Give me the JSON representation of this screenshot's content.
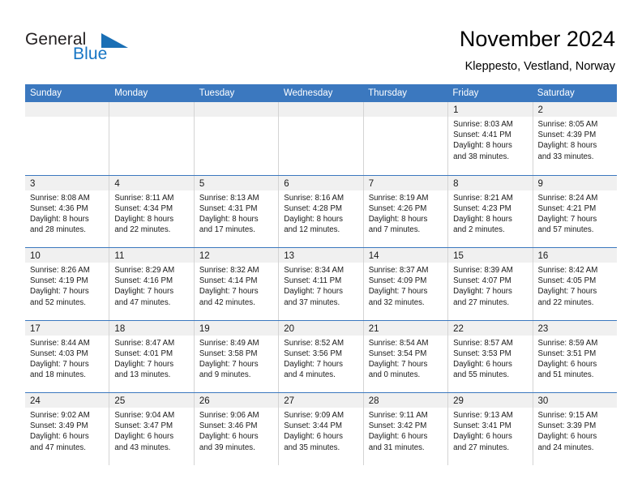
{
  "brand": {
    "name_part1": "General",
    "name_part2": "Blue",
    "triangle_color": "#1a6fb5",
    "blue_color": "#1675c4"
  },
  "header": {
    "title": "November 2024",
    "subtitle": "Kleppesto, Vestland, Norway"
  },
  "theme": {
    "header_bg": "#3b78bf",
    "day_band_bg": "#f0f0f0",
    "cell_border": "#d4d4d4",
    "week_divider": "#3b78bf"
  },
  "weekdays": [
    "Sunday",
    "Monday",
    "Tuesday",
    "Wednesday",
    "Thursday",
    "Friday",
    "Saturday"
  ],
  "weeks": [
    [
      {
        "day": "",
        "empty": true
      },
      {
        "day": "",
        "empty": true
      },
      {
        "day": "",
        "empty": true
      },
      {
        "day": "",
        "empty": true
      },
      {
        "day": "",
        "empty": true
      },
      {
        "day": "1",
        "sunrise": "Sunrise: 8:03 AM",
        "sunset": "Sunset: 4:41 PM",
        "daylight_line1": "Daylight: 8 hours",
        "daylight_line2": "and 38 minutes."
      },
      {
        "day": "2",
        "sunrise": "Sunrise: 8:05 AM",
        "sunset": "Sunset: 4:39 PM",
        "daylight_line1": "Daylight: 8 hours",
        "daylight_line2": "and 33 minutes."
      }
    ],
    [
      {
        "day": "3",
        "sunrise": "Sunrise: 8:08 AM",
        "sunset": "Sunset: 4:36 PM",
        "daylight_line1": "Daylight: 8 hours",
        "daylight_line2": "and 28 minutes."
      },
      {
        "day": "4",
        "sunrise": "Sunrise: 8:11 AM",
        "sunset": "Sunset: 4:34 PM",
        "daylight_line1": "Daylight: 8 hours",
        "daylight_line2": "and 22 minutes."
      },
      {
        "day": "5",
        "sunrise": "Sunrise: 8:13 AM",
        "sunset": "Sunset: 4:31 PM",
        "daylight_line1": "Daylight: 8 hours",
        "daylight_line2": "and 17 minutes."
      },
      {
        "day": "6",
        "sunrise": "Sunrise: 8:16 AM",
        "sunset": "Sunset: 4:28 PM",
        "daylight_line1": "Daylight: 8 hours",
        "daylight_line2": "and 12 minutes."
      },
      {
        "day": "7",
        "sunrise": "Sunrise: 8:19 AM",
        "sunset": "Sunset: 4:26 PM",
        "daylight_line1": "Daylight: 8 hours",
        "daylight_line2": "and 7 minutes."
      },
      {
        "day": "8",
        "sunrise": "Sunrise: 8:21 AM",
        "sunset": "Sunset: 4:23 PM",
        "daylight_line1": "Daylight: 8 hours",
        "daylight_line2": "and 2 minutes."
      },
      {
        "day": "9",
        "sunrise": "Sunrise: 8:24 AM",
        "sunset": "Sunset: 4:21 PM",
        "daylight_line1": "Daylight: 7 hours",
        "daylight_line2": "and 57 minutes."
      }
    ],
    [
      {
        "day": "10",
        "sunrise": "Sunrise: 8:26 AM",
        "sunset": "Sunset: 4:19 PM",
        "daylight_line1": "Daylight: 7 hours",
        "daylight_line2": "and 52 minutes."
      },
      {
        "day": "11",
        "sunrise": "Sunrise: 8:29 AM",
        "sunset": "Sunset: 4:16 PM",
        "daylight_line1": "Daylight: 7 hours",
        "daylight_line2": "and 47 minutes."
      },
      {
        "day": "12",
        "sunrise": "Sunrise: 8:32 AM",
        "sunset": "Sunset: 4:14 PM",
        "daylight_line1": "Daylight: 7 hours",
        "daylight_line2": "and 42 minutes."
      },
      {
        "day": "13",
        "sunrise": "Sunrise: 8:34 AM",
        "sunset": "Sunset: 4:11 PM",
        "daylight_line1": "Daylight: 7 hours",
        "daylight_line2": "and 37 minutes."
      },
      {
        "day": "14",
        "sunrise": "Sunrise: 8:37 AM",
        "sunset": "Sunset: 4:09 PM",
        "daylight_line1": "Daylight: 7 hours",
        "daylight_line2": "and 32 minutes."
      },
      {
        "day": "15",
        "sunrise": "Sunrise: 8:39 AM",
        "sunset": "Sunset: 4:07 PM",
        "daylight_line1": "Daylight: 7 hours",
        "daylight_line2": "and 27 minutes."
      },
      {
        "day": "16",
        "sunrise": "Sunrise: 8:42 AM",
        "sunset": "Sunset: 4:05 PM",
        "daylight_line1": "Daylight: 7 hours",
        "daylight_line2": "and 22 minutes."
      }
    ],
    [
      {
        "day": "17",
        "sunrise": "Sunrise: 8:44 AM",
        "sunset": "Sunset: 4:03 PM",
        "daylight_line1": "Daylight: 7 hours",
        "daylight_line2": "and 18 minutes."
      },
      {
        "day": "18",
        "sunrise": "Sunrise: 8:47 AM",
        "sunset": "Sunset: 4:01 PM",
        "daylight_line1": "Daylight: 7 hours",
        "daylight_line2": "and 13 minutes."
      },
      {
        "day": "19",
        "sunrise": "Sunrise: 8:49 AM",
        "sunset": "Sunset: 3:58 PM",
        "daylight_line1": "Daylight: 7 hours",
        "daylight_line2": "and 9 minutes."
      },
      {
        "day": "20",
        "sunrise": "Sunrise: 8:52 AM",
        "sunset": "Sunset: 3:56 PM",
        "daylight_line1": "Daylight: 7 hours",
        "daylight_line2": "and 4 minutes."
      },
      {
        "day": "21",
        "sunrise": "Sunrise: 8:54 AM",
        "sunset": "Sunset: 3:54 PM",
        "daylight_line1": "Daylight: 7 hours",
        "daylight_line2": "and 0 minutes."
      },
      {
        "day": "22",
        "sunrise": "Sunrise: 8:57 AM",
        "sunset": "Sunset: 3:53 PM",
        "daylight_line1": "Daylight: 6 hours",
        "daylight_line2": "and 55 minutes."
      },
      {
        "day": "23",
        "sunrise": "Sunrise: 8:59 AM",
        "sunset": "Sunset: 3:51 PM",
        "daylight_line1": "Daylight: 6 hours",
        "daylight_line2": "and 51 minutes."
      }
    ],
    [
      {
        "day": "24",
        "sunrise": "Sunrise: 9:02 AM",
        "sunset": "Sunset: 3:49 PM",
        "daylight_line1": "Daylight: 6 hours",
        "daylight_line2": "and 47 minutes."
      },
      {
        "day": "25",
        "sunrise": "Sunrise: 9:04 AM",
        "sunset": "Sunset: 3:47 PM",
        "daylight_line1": "Daylight: 6 hours",
        "daylight_line2": "and 43 minutes."
      },
      {
        "day": "26",
        "sunrise": "Sunrise: 9:06 AM",
        "sunset": "Sunset: 3:46 PM",
        "daylight_line1": "Daylight: 6 hours",
        "daylight_line2": "and 39 minutes."
      },
      {
        "day": "27",
        "sunrise": "Sunrise: 9:09 AM",
        "sunset": "Sunset: 3:44 PM",
        "daylight_line1": "Daylight: 6 hours",
        "daylight_line2": "and 35 minutes."
      },
      {
        "day": "28",
        "sunrise": "Sunrise: 9:11 AM",
        "sunset": "Sunset: 3:42 PM",
        "daylight_line1": "Daylight: 6 hours",
        "daylight_line2": "and 31 minutes."
      },
      {
        "day": "29",
        "sunrise": "Sunrise: 9:13 AM",
        "sunset": "Sunset: 3:41 PM",
        "daylight_line1": "Daylight: 6 hours",
        "daylight_line2": "and 27 minutes."
      },
      {
        "day": "30",
        "sunrise": "Sunrise: 9:15 AM",
        "sunset": "Sunset: 3:39 PM",
        "daylight_line1": "Daylight: 6 hours",
        "daylight_line2": "and 24 minutes."
      }
    ]
  ]
}
